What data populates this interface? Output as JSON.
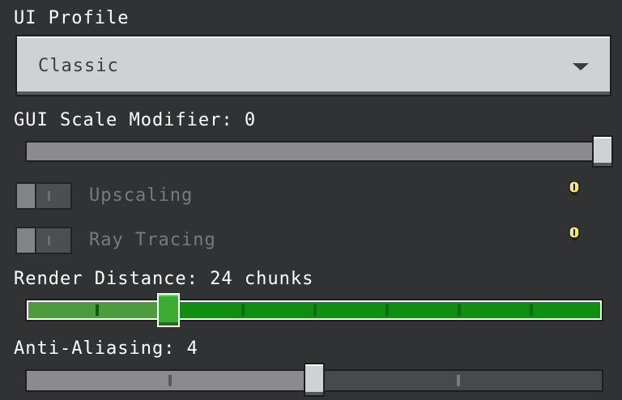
{
  "ui_profile": {
    "label": "UI Profile",
    "selected": "Classic"
  },
  "gui_scale": {
    "label": "GUI Scale Modifier: 0",
    "value": 0,
    "position_fraction": 1.0
  },
  "upscaling": {
    "label": "Upscaling",
    "enabled": false,
    "info_icon": "info-icon"
  },
  "ray_tracing": {
    "label": "Ray Tracing",
    "enabled": false,
    "info_icon": "info-icon"
  },
  "render_distance": {
    "label": "Render Distance: 24 chunks",
    "value": 24,
    "position_fraction": 0.25,
    "steps": 8
  },
  "anti_aliasing": {
    "label": "Anti-Aliasing: 4",
    "value": 4,
    "position_fraction": 0.5,
    "steps": 4
  },
  "colors": {
    "background": "#313233",
    "slider_active": "#118d11",
    "slider_active_faded": "#4d9b3d",
    "thumb_green": "#3cac33",
    "disabled_text": "#7a7a7b"
  }
}
